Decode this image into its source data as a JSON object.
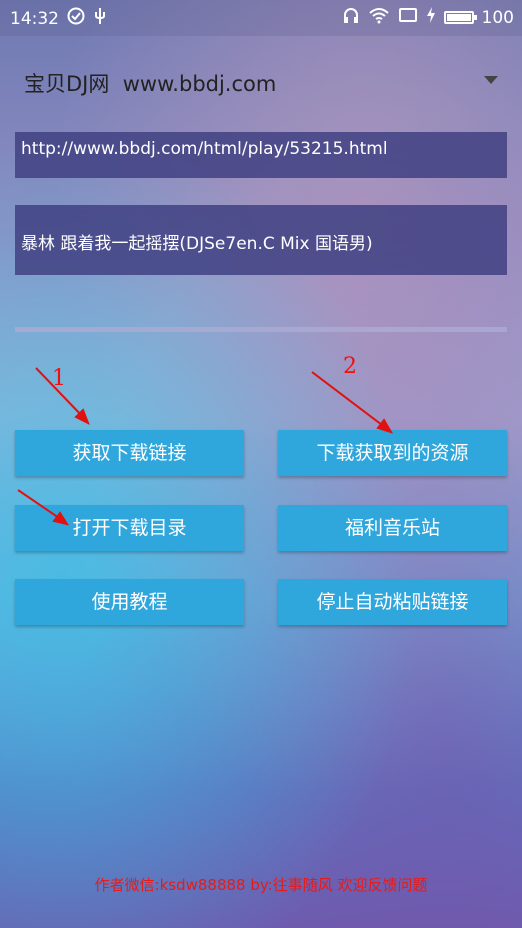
{
  "status_bar": {
    "time": "14:32",
    "battery_level": "100",
    "battery_fraction": 1.0,
    "icons": [
      "check-circle-icon",
      "usb-icon",
      "headphones-icon",
      "wifi-icon",
      "screen-icon",
      "charging-icon",
      "battery-icon"
    ]
  },
  "site_selector": {
    "selected": "宝贝DJ网  www.bbdj.com"
  },
  "url_field": {
    "value": "http://www.bbdj.com/html/play/53215.html"
  },
  "title_field": {
    "value": "暴林 跟着我一起摇摆(DJSe7en.C Mix 国语男)"
  },
  "buttons": {
    "get_link": "获取下载链接",
    "download_resource": "下载获取到的资源",
    "open_dir": "打开下载目录",
    "welfare_music": "福利音乐站",
    "tutorial": "使用教程",
    "stop_paste": "停止自动粘贴链接"
  },
  "annotations": {
    "label_1": "1",
    "label_2": "2",
    "color": "#e11111"
  },
  "footer": {
    "text": "作者微信:ksdw88888  by:往事随风 欢迎反馈问题"
  },
  "colors": {
    "button": "#2fa7dd",
    "field": "#41418a",
    "footer_text": "#e41b1b"
  }
}
